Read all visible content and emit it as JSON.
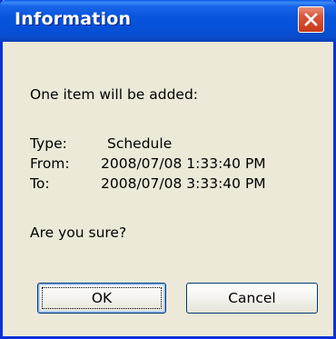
{
  "window": {
    "title": "Information"
  },
  "message": {
    "intro": "One item will be added:",
    "type_label": "Type:",
    "type_value": "Schedule",
    "from_label": "From:",
    "from_value": "2008/07/08 1:33:40 PM",
    "to_label": "To:",
    "to_value": "2008/07/08 3:33:40 PM",
    "question": "Are you sure?"
  },
  "buttons": {
    "ok_label": "OK",
    "cancel_label": "Cancel"
  },
  "icons": {
    "close": "close-icon"
  },
  "colors": {
    "titlebar": "#0855dd",
    "close_button": "#d9573c",
    "dialog_background": "#ece9d8"
  }
}
